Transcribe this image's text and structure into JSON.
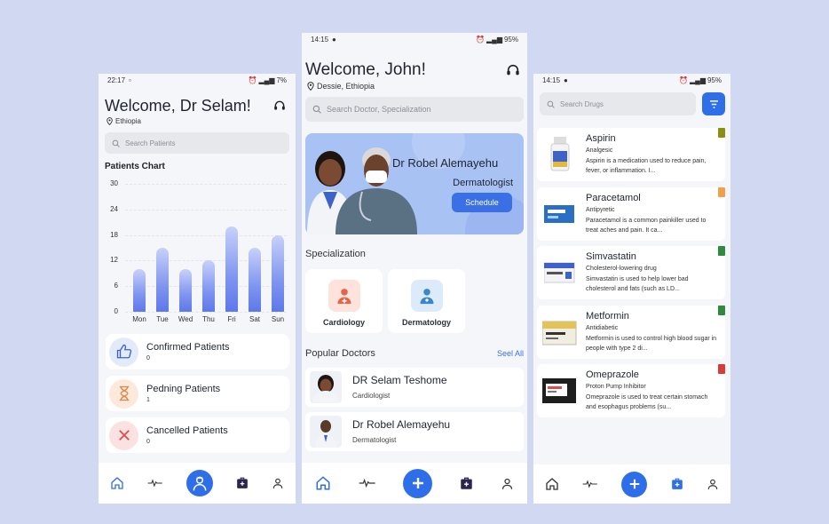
{
  "screen1": {
    "status": {
      "time": "22:17",
      "battery": "7%"
    },
    "title": "Welcome, Dr Selam!",
    "location": "Ethiopia",
    "search_placeholder": "Search Patients",
    "chart_heading": "Patients Chart",
    "chart_data": {
      "type": "bar",
      "title": "Patients Chart",
      "categories": [
        "Mon",
        "Tue",
        "Wed",
        "Thu",
        "Fri",
        "Sat",
        "Sun"
      ],
      "values": [
        10,
        15,
        10,
        12,
        20,
        15,
        18
      ],
      "ylim": [
        0,
        30
      ],
      "yticks": [
        "30",
        "24",
        "18",
        "12",
        "6",
        "0"
      ],
      "grid": true
    },
    "stats": [
      {
        "label": "Confirmed Patients",
        "count": "0",
        "icon": "thumbs-up-icon",
        "color": "#3d63c9"
      },
      {
        "label": "Pedning Patients",
        "count": "1",
        "icon": "hourglass-icon",
        "color": "#d9894a"
      },
      {
        "label": "Cancelled Patients",
        "count": "0",
        "icon": "x-icon",
        "color": "#e34a4a"
      }
    ],
    "nav": [
      "home-icon",
      "activity-icon",
      "doctor-icon",
      "medical-box-icon",
      "profile-icon"
    ]
  },
  "screen2": {
    "status": {
      "time": "14:15",
      "battery": "95%"
    },
    "title": "Welcome, John!",
    "location": "Dessie, Ethiopia",
    "search_placeholder": "Search Doctor, Specialization",
    "banner": {
      "doctor_name": "Dr Robel Alemayehu",
      "specialty": "Dermatologist",
      "button": "Schedule"
    },
    "specialization_heading": "Specialization",
    "specializations": [
      {
        "label": "Cardiology",
        "icon": "cardiology-icon"
      },
      {
        "label": "Dermatology",
        "icon": "dermatology-icon"
      }
    ],
    "popular_heading": "Popular Doctors",
    "see_all": "Seel All",
    "doctors": [
      {
        "name": "DR Selam Teshome",
        "specialty": "Cardiologist"
      },
      {
        "name": "Dr Robel Alemayehu",
        "specialty": "Dermatologist"
      }
    ]
  },
  "screen3": {
    "status": {
      "time": "14:15",
      "battery": "95%"
    },
    "search_placeholder": "Search Drugs",
    "drugs": [
      {
        "name": "Aspirin",
        "category": "Analgesic",
        "desc": "Aspirin is a medication used to reduce pain, fever, or inflammation. I...",
        "flag": "#8a8f12"
      },
      {
        "name": "Paracetamol",
        "category": "Antipyretic",
        "desc": "Paracetamol is a common painkiller used to treat aches and pain. It ca...",
        "flag": "#f0a04a"
      },
      {
        "name": "Simvastatin",
        "category": "Cholesterol-lowering drug",
        "desc": "Simvastatin is used to help lower bad cholesterol and fats (such as LD...",
        "flag": "#2f8a3e"
      },
      {
        "name": "Metformin",
        "category": "Antidiabetic",
        "desc": "Metformin is used to control high blood sugar in people with type 2 di...",
        "flag": "#2f8a3e"
      },
      {
        "name": "Omeprazole",
        "category": "Proton Pump Inhibitor",
        "desc": "Omeprazole is used to treat certain stomach and esophagus problems (su...",
        "flag": "#d93a3a"
      }
    ]
  }
}
